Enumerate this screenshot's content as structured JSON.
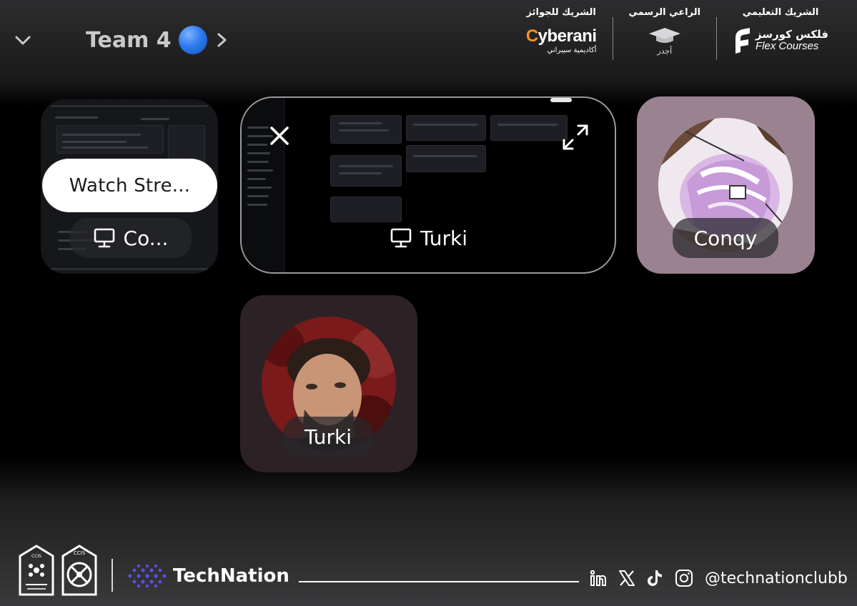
{
  "header": {
    "team_name": "Team 4",
    "partners": [
      {
        "label": "الشريك للجوائز",
        "brand": "Cyberani",
        "brand_sub": "أكاديمية سيبراني"
      },
      {
        "label": "الراعي الرسمي",
        "brand": "أجدر"
      },
      {
        "label": "الشريك التعليمي",
        "brand_ar": "فلكس كورسز",
        "brand_en": "Flex Courses"
      }
    ],
    "colors": {
      "cyberani_accent": "#f7941d",
      "status_dot": "#2f7cf0"
    }
  },
  "tiles": [
    {
      "name": "Co...",
      "type": "stream",
      "action_label": "Watch Stre...",
      "icon": "monitor-icon"
    },
    {
      "name": "Turki",
      "type": "stream-focused",
      "icon": "monitor-icon",
      "controls": [
        "close-icon",
        "expand-icon"
      ]
    },
    {
      "name": "Conqy",
      "type": "avatar"
    },
    {
      "name": "Turki",
      "type": "avatar"
    }
  ],
  "footer": {
    "brand": "TechNation",
    "handle": "@technationclubb",
    "council_logos": [
      "CCIS",
      "CCIS"
    ],
    "social_icons": [
      "linkedin-icon",
      "x-icon",
      "tiktok-icon",
      "instagram-icon"
    ]
  }
}
